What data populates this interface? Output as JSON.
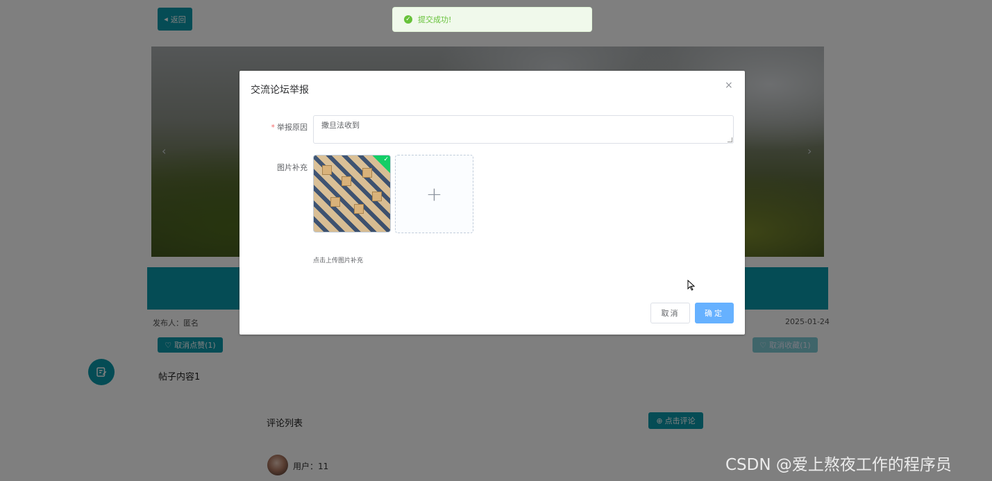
{
  "page": {
    "back_label": "返回",
    "publisher": "发布人：匿名",
    "date": "2025-01-24",
    "like_label": "取消点赞(1)",
    "favorite_label": "取消收藏(1)",
    "post_content": "帖子内容1",
    "comment_list_title": "评论列表",
    "comment_button_label": "点击评论",
    "comment_user": "用户：11",
    "banner_prev": "‹",
    "banner_next": "›"
  },
  "toast": {
    "message": "提交成功!",
    "type": "success"
  },
  "dialog": {
    "title": "交流论坛举报",
    "close_symbol": "×",
    "fields": {
      "reason": {
        "label": "举报原因",
        "required_mark": "*",
        "value": "撒旦法收到"
      },
      "images": {
        "label": "图片补充",
        "uploaded_count": 1,
        "tip": "点击上传图片补充"
      }
    },
    "cancel_label": "取消",
    "confirm_label": "确定"
  },
  "watermark": "CSDN @爱上熬夜工作的程序员",
  "colors": {
    "primary": "#0b98ab",
    "confirm": "#66b1ff",
    "success": "#67c23a",
    "upload_badge": "#13ce66"
  }
}
